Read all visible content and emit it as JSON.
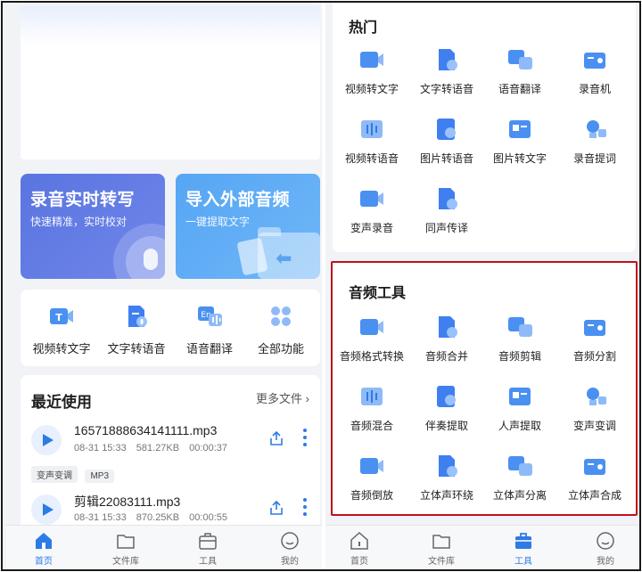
{
  "left": {
    "cards": {
      "realtime": {
        "title": "录音实时转写",
        "subtitle": "快速精准，实时校对"
      },
      "import": {
        "title": "导入外部音频",
        "subtitle": "一键提取文字"
      }
    },
    "quick": [
      {
        "label": "视频转文字",
        "icon": "video-to-text-icon"
      },
      {
        "label": "文字转语音",
        "icon": "text-to-speech-icon"
      },
      {
        "label": "语音翻译",
        "icon": "voice-translate-icon"
      },
      {
        "label": "全部功能",
        "icon": "all-functions-icon"
      }
    ],
    "recent": {
      "title": "最近使用",
      "more": "更多文件",
      "files": [
        {
          "name": "16571888634141111.mp3",
          "date": "08-31 15:33",
          "size": "581.27KB",
          "duration": "00:00:37"
        },
        {
          "name": "剪辑22083111.mp3",
          "date": "08-31 15:33",
          "size": "870.25KB",
          "duration": "00:00:55"
        }
      ],
      "tags": [
        "变声变调",
        "MP3"
      ]
    },
    "tabs": [
      {
        "label": "首页",
        "active": true
      },
      {
        "label": "文件库",
        "active": false
      },
      {
        "label": "工具",
        "active": false
      },
      {
        "label": "我的",
        "active": false
      }
    ]
  },
  "right": {
    "hot": {
      "title": "热门",
      "items": [
        {
          "label": "视频转文字",
          "icon": "video-to-text-icon"
        },
        {
          "label": "文字转语音",
          "icon": "text-to-speech-icon"
        },
        {
          "label": "语音翻译",
          "icon": "voice-translate-icon"
        },
        {
          "label": "录音机",
          "icon": "recorder-icon"
        },
        {
          "label": "视频转语音",
          "icon": "video-to-audio-icon"
        },
        {
          "label": "图片转语音",
          "icon": "image-to-audio-icon"
        },
        {
          "label": "图片转文字",
          "icon": "image-to-text-icon"
        },
        {
          "label": "录音提词",
          "icon": "teleprompter-icon"
        },
        {
          "label": "变声录音",
          "icon": "voice-change-record-icon"
        },
        {
          "label": "同声传译",
          "icon": "simultaneous-interpret-icon"
        }
      ]
    },
    "audio_tools": {
      "title": "音频工具",
      "items": [
        {
          "label": "音频格式转换",
          "icon": "format-convert-icon"
        },
        {
          "label": "音频合并",
          "icon": "audio-merge-icon"
        },
        {
          "label": "音频剪辑",
          "icon": "audio-clip-icon"
        },
        {
          "label": "音频分割",
          "icon": "audio-split-icon"
        },
        {
          "label": "音频混合",
          "icon": "audio-mix-icon"
        },
        {
          "label": "伴奏提取",
          "icon": "accompaniment-extract-icon"
        },
        {
          "label": "人声提取",
          "icon": "vocal-extract-icon"
        },
        {
          "label": "变声变调",
          "icon": "pitch-change-icon"
        },
        {
          "label": "音频倒放",
          "icon": "audio-reverse-icon"
        },
        {
          "label": "立体声环绕",
          "icon": "stereo-surround-icon"
        },
        {
          "label": "立体声分离",
          "icon": "stereo-separate-icon"
        },
        {
          "label": "立体声合成",
          "icon": "stereo-compose-icon"
        }
      ]
    },
    "tabs": [
      {
        "label": "首页",
        "active": false
      },
      {
        "label": "文件库",
        "active": false
      },
      {
        "label": "工具",
        "active": true
      },
      {
        "label": "我的",
        "active": false
      }
    ]
  },
  "colors": {
    "accent": "#2d7be5",
    "highlight_box": "#c0121a"
  }
}
